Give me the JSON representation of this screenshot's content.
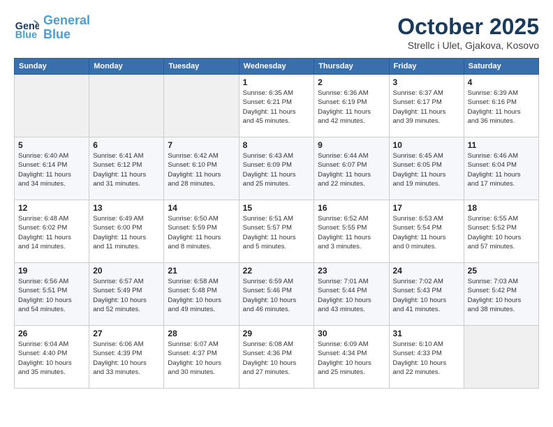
{
  "header": {
    "logo_line1": "General",
    "logo_line2": "Blue",
    "month": "October 2025",
    "location": "Strellc i Ulet, Gjakova, Kosovo"
  },
  "weekdays": [
    "Sunday",
    "Monday",
    "Tuesday",
    "Wednesday",
    "Thursday",
    "Friday",
    "Saturday"
  ],
  "weeks": [
    [
      {
        "day": "",
        "info": ""
      },
      {
        "day": "",
        "info": ""
      },
      {
        "day": "",
        "info": ""
      },
      {
        "day": "1",
        "info": "Sunrise: 6:35 AM\nSunset: 6:21 PM\nDaylight: 11 hours\nand 45 minutes."
      },
      {
        "day": "2",
        "info": "Sunrise: 6:36 AM\nSunset: 6:19 PM\nDaylight: 11 hours\nand 42 minutes."
      },
      {
        "day": "3",
        "info": "Sunrise: 6:37 AM\nSunset: 6:17 PM\nDaylight: 11 hours\nand 39 minutes."
      },
      {
        "day": "4",
        "info": "Sunrise: 6:39 AM\nSunset: 6:16 PM\nDaylight: 11 hours\nand 36 minutes."
      }
    ],
    [
      {
        "day": "5",
        "info": "Sunrise: 6:40 AM\nSunset: 6:14 PM\nDaylight: 11 hours\nand 34 minutes."
      },
      {
        "day": "6",
        "info": "Sunrise: 6:41 AM\nSunset: 6:12 PM\nDaylight: 11 hours\nand 31 minutes."
      },
      {
        "day": "7",
        "info": "Sunrise: 6:42 AM\nSunset: 6:10 PM\nDaylight: 11 hours\nand 28 minutes."
      },
      {
        "day": "8",
        "info": "Sunrise: 6:43 AM\nSunset: 6:09 PM\nDaylight: 11 hours\nand 25 minutes."
      },
      {
        "day": "9",
        "info": "Sunrise: 6:44 AM\nSunset: 6:07 PM\nDaylight: 11 hours\nand 22 minutes."
      },
      {
        "day": "10",
        "info": "Sunrise: 6:45 AM\nSunset: 6:05 PM\nDaylight: 11 hours\nand 19 minutes."
      },
      {
        "day": "11",
        "info": "Sunrise: 6:46 AM\nSunset: 6:04 PM\nDaylight: 11 hours\nand 17 minutes."
      }
    ],
    [
      {
        "day": "12",
        "info": "Sunrise: 6:48 AM\nSunset: 6:02 PM\nDaylight: 11 hours\nand 14 minutes."
      },
      {
        "day": "13",
        "info": "Sunrise: 6:49 AM\nSunset: 6:00 PM\nDaylight: 11 hours\nand 11 minutes."
      },
      {
        "day": "14",
        "info": "Sunrise: 6:50 AM\nSunset: 5:59 PM\nDaylight: 11 hours\nand 8 minutes."
      },
      {
        "day": "15",
        "info": "Sunrise: 6:51 AM\nSunset: 5:57 PM\nDaylight: 11 hours\nand 5 minutes."
      },
      {
        "day": "16",
        "info": "Sunrise: 6:52 AM\nSunset: 5:55 PM\nDaylight: 11 hours\nand 3 minutes."
      },
      {
        "day": "17",
        "info": "Sunrise: 6:53 AM\nSunset: 5:54 PM\nDaylight: 11 hours\nand 0 minutes."
      },
      {
        "day": "18",
        "info": "Sunrise: 6:55 AM\nSunset: 5:52 PM\nDaylight: 10 hours\nand 57 minutes."
      }
    ],
    [
      {
        "day": "19",
        "info": "Sunrise: 6:56 AM\nSunset: 5:51 PM\nDaylight: 10 hours\nand 54 minutes."
      },
      {
        "day": "20",
        "info": "Sunrise: 6:57 AM\nSunset: 5:49 PM\nDaylight: 10 hours\nand 52 minutes."
      },
      {
        "day": "21",
        "info": "Sunrise: 6:58 AM\nSunset: 5:48 PM\nDaylight: 10 hours\nand 49 minutes."
      },
      {
        "day": "22",
        "info": "Sunrise: 6:59 AM\nSunset: 5:46 PM\nDaylight: 10 hours\nand 46 minutes."
      },
      {
        "day": "23",
        "info": "Sunrise: 7:01 AM\nSunset: 5:44 PM\nDaylight: 10 hours\nand 43 minutes."
      },
      {
        "day": "24",
        "info": "Sunrise: 7:02 AM\nSunset: 5:43 PM\nDaylight: 10 hours\nand 41 minutes."
      },
      {
        "day": "25",
        "info": "Sunrise: 7:03 AM\nSunset: 5:42 PM\nDaylight: 10 hours\nand 38 minutes."
      }
    ],
    [
      {
        "day": "26",
        "info": "Sunrise: 6:04 AM\nSunset: 4:40 PM\nDaylight: 10 hours\nand 35 minutes."
      },
      {
        "day": "27",
        "info": "Sunrise: 6:06 AM\nSunset: 4:39 PM\nDaylight: 10 hours\nand 33 minutes."
      },
      {
        "day": "28",
        "info": "Sunrise: 6:07 AM\nSunset: 4:37 PM\nDaylight: 10 hours\nand 30 minutes."
      },
      {
        "day": "29",
        "info": "Sunrise: 6:08 AM\nSunset: 4:36 PM\nDaylight: 10 hours\nand 27 minutes."
      },
      {
        "day": "30",
        "info": "Sunrise: 6:09 AM\nSunset: 4:34 PM\nDaylight: 10 hours\nand 25 minutes."
      },
      {
        "day": "31",
        "info": "Sunrise: 6:10 AM\nSunset: 4:33 PM\nDaylight: 10 hours\nand 22 minutes."
      },
      {
        "day": "",
        "info": ""
      }
    ]
  ]
}
